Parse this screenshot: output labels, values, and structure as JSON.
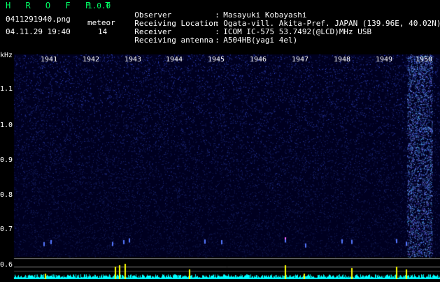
{
  "app": {
    "title": "H R O F F T",
    "version": "1.0.0"
  },
  "info": {
    "file_name": "0411291940.png",
    "date_time": "04.11.29 19:40",
    "meteor_label": "meteor",
    "meteor_count": "14"
  },
  "metadata": [
    {
      "key": "Observer",
      "value": "Masayuki Kobayashi"
    },
    {
      "key": "Receiving Location",
      "value": "Ogata-vill. Akita-Pref. JAPAN (139.96E, 40.02N)"
    },
    {
      "key": "Receiver",
      "value": "ICOM IC-575 53.7492(@LCD)MHz USB"
    },
    {
      "key": "Receiving antenna",
      "value": "A504HB(yagi 4el)"
    }
  ],
  "spectrogram": {
    "y_unit": "kHz",
    "y_ticks": [
      "1.1",
      "1.0",
      "0.9",
      "0.8",
      "0.7",
      "0.6"
    ],
    "x_ticks": [
      "1941",
      "1942",
      "1943",
      "1944",
      "1945",
      "1946",
      "1947",
      "1948",
      "1949",
      "1950"
    ],
    "colors": {
      "background": "#000020",
      "noise": "#1a2cc8",
      "echo": "#ffff00",
      "trace": "#00ffff"
    }
  }
}
